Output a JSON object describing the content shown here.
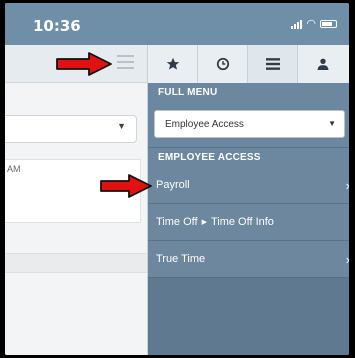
{
  "status_bar": {
    "time": "10:36"
  },
  "menu": {
    "tabs": [
      {
        "icon": "star-icon"
      },
      {
        "icon": "clock-icon"
      },
      {
        "icon": "list-icon",
        "active": true
      },
      {
        "icon": "user-icon"
      }
    ],
    "full_menu_title": "FULL MENU",
    "selected_module": "Employee Access",
    "section_title": "EMPLOYEE ACCESS",
    "items": [
      {
        "label": "Payroll",
        "has_chevron": true
      },
      {
        "label_a": "Time Off",
        "label_b": "Time Off Info",
        "has_chevron": false
      },
      {
        "label": "True Time",
        "has_chevron": true
      }
    ]
  },
  "left_pane": {
    "card_fragment": "AM"
  },
  "colors": {
    "status_bar": "#6f8fa9",
    "menu_bg": "#6d879e",
    "annotation_arrow": "#e11111"
  }
}
